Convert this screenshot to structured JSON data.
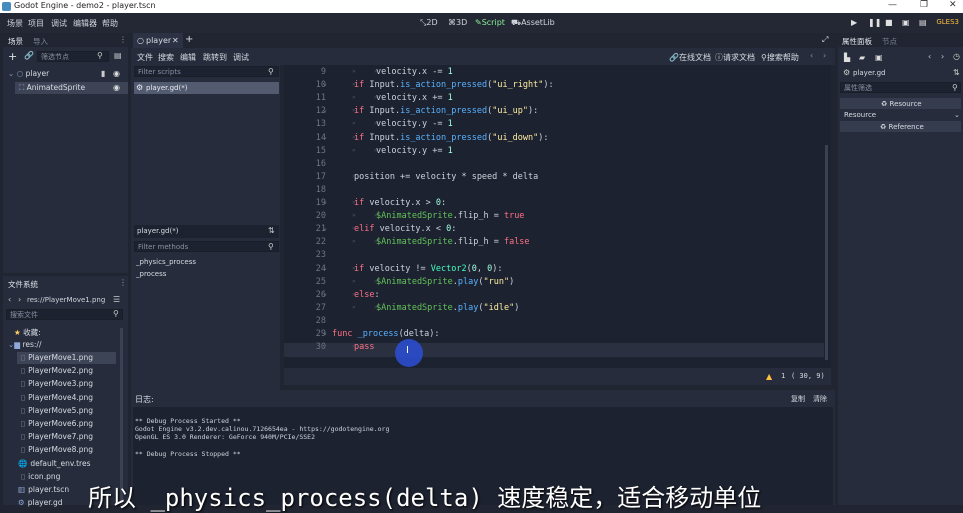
{
  "window": {
    "title": "Godot Engine - demo2 - player.tscn"
  },
  "menu": [
    "场景",
    "项目",
    "调试",
    "编辑器",
    "帮助"
  ],
  "workspaces": [
    {
      "label": "2D",
      "icon": "2d-icon",
      "active": false
    },
    {
      "label": "3D",
      "icon": "3d-icon",
      "active": false
    },
    {
      "label": "Script",
      "icon": "script-icon",
      "active": true
    },
    {
      "label": "AssetLib",
      "icon": "assetlib-icon",
      "active": false
    }
  ],
  "renderer": "GLES3",
  "scene_dock": {
    "tabs": [
      "场景",
      "导入"
    ],
    "filter_placeholder": "筛选节点",
    "nodes": [
      {
        "label": "player"
      },
      {
        "label": "AnimatedSprite"
      }
    ]
  },
  "filesystem": {
    "title": "文件系统",
    "path": "res://PlayerMove1.png",
    "search_placeholder": "搜索文件",
    "favorites": "收藏:",
    "root": "res://",
    "files": [
      "PlayerMove1.png",
      "PlayerMove2.png",
      "PlayerMove3.png",
      "PlayerMove4.png",
      "PlayerMove5.png",
      "PlayerMove6.png",
      "PlayerMove7.png",
      "PlayerMove8.png",
      "default_env.tres",
      "icon.png",
      "player.tscn",
      "player.gd"
    ]
  },
  "script_editor": {
    "scene_tab": "player",
    "menu": [
      "文件",
      "搜索",
      "编辑",
      "跳转到",
      "调试"
    ],
    "right_menu": [
      "在线文档",
      "请求文档",
      "搜索帮助"
    ],
    "filter_scripts_placeholder": "Filter scripts",
    "scripts": [
      "player.gd(*)"
    ],
    "current_script": "player.gd(*)",
    "filter_methods_placeholder": "Filter methods",
    "methods": [
      "_physics_process",
      "_process"
    ],
    "status": {
      "warnings": "1",
      "position": "( 30, 9)"
    }
  },
  "code_lines": [
    {
      "n": "9",
      "text": "velocity.x -= 1"
    },
    {
      "n": "10",
      "text": "if Input.is_action_pressed(\"ui_right\"):"
    },
    {
      "n": "11",
      "text": "velocity.x += 1"
    },
    {
      "n": "12",
      "text": "if Input.is_action_pressed(\"ui_up\"):"
    },
    {
      "n": "13",
      "text": "velocity.y -= 1"
    },
    {
      "n": "14",
      "text": "if Input.is_action_pressed(\"ui_down\"):"
    },
    {
      "n": "15",
      "text": "velocity.y += 1"
    },
    {
      "n": "16",
      "text": ""
    },
    {
      "n": "17",
      "text": "position += velocity * speed * delta"
    },
    {
      "n": "18",
      "text": ""
    },
    {
      "n": "19",
      "text": "if velocity.x > 0:"
    },
    {
      "n": "20",
      "text": "$AnimatedSprite.flip_h = true"
    },
    {
      "n": "21",
      "text": "elif velocity.x < 0:"
    },
    {
      "n": "22",
      "text": "$AnimatedSprite.flip_h = false"
    },
    {
      "n": "23",
      "text": ""
    },
    {
      "n": "24",
      "text": "if velocity != Vector2(0, 0):"
    },
    {
      "n": "25",
      "text": "$AnimatedSprite.play(\"run\")"
    },
    {
      "n": "26",
      "text": "else:"
    },
    {
      "n": "27",
      "text": "$AnimatedSprite.play(\"idle\")"
    },
    {
      "n": "28",
      "text": ""
    },
    {
      "n": "29",
      "text": "func _process(delta):"
    },
    {
      "n": "30",
      "text": "pass"
    }
  ],
  "output": {
    "title": "日志:",
    "copy": "复制",
    "clear": "清除",
    "lines": [
      "** Debug Process Started **",
      "Godot Engine v3.2.dev.calinou.7126654ea - https://godotengine.org",
      "OpenGL ES 3.0 Renderer: GeForce 940M/PCIe/SSE2",
      "",
      "** Debug Process Stopped **"
    ]
  },
  "inspector": {
    "tabs": [
      "属性面板",
      "节点"
    ],
    "object": "player.gd",
    "filter_placeholder": "属性筛选",
    "resource_button": "Resource",
    "section": "Resource",
    "reference_button": "Reference"
  },
  "subtitle": "所以 _physics_process(delta) 速度稳定，适合移动单位",
  "colors": {
    "accent": "#699ce8",
    "script_active": "#8eef97",
    "warning": "#ffbf3f"
  }
}
